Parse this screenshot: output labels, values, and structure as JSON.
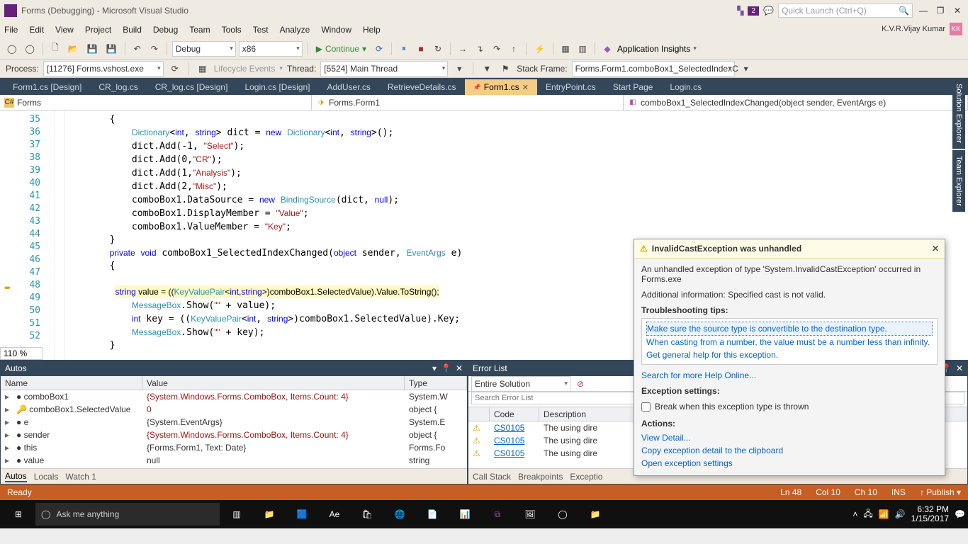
{
  "title": "Forms (Debugging) - Microsoft Visual Studio",
  "quicklaunch_placeholder": "Quick Launch (Ctrl+Q)",
  "user": {
    "name": "K.V.R.Vijay Kumar",
    "initials": "KK"
  },
  "notif_count": "2",
  "menu": [
    "File",
    "Edit",
    "View",
    "Project",
    "Build",
    "Debug",
    "Team",
    "Tools",
    "Test",
    "Analyze",
    "Window",
    "Help"
  ],
  "toolbar": {
    "config": "Debug",
    "platform": "x86",
    "continue": "Continue",
    "insights": "Application Insights"
  },
  "debugbar": {
    "process_label": "Process:",
    "process": "[11276] Forms.vshost.exe",
    "lifecycle": "Lifecycle Events",
    "thread_label": "Thread:",
    "thread": "[5524] Main Thread",
    "stackframe_label": "Stack Frame:",
    "stackframe": "Forms.Form1.comboBox1_SelectedIndexC"
  },
  "tabs": [
    "Form1.cs [Design]",
    "CR_log.cs",
    "CR_log.cs [Design]",
    "Login.cs [Design]",
    "AddUser.cs",
    "RetrieveDetails.cs",
    "Form1.cs",
    "EntryPoint.cs",
    "Start Page",
    "Login.cs"
  ],
  "active_tab": "Form1.cs",
  "nav": {
    "left": "Forms",
    "mid": "Forms.Form1",
    "right": "comboBox1_SelectedIndexChanged(object sender, EventArgs e)"
  },
  "lines": {
    "start": 35,
    "end": 52
  },
  "zoom": "110 %",
  "side_tabs": [
    "Solution Explorer",
    "Team Explorer"
  ],
  "autos": {
    "title": "Autos",
    "cols": [
      "Name",
      "Value",
      "Type"
    ],
    "rows": [
      {
        "name": "comboBox1",
        "value": "{System.Windows.Forms.ComboBox, Items.Count: 4}",
        "type": "System.W",
        "red": true
      },
      {
        "name": "comboBox1.SelectedValue",
        "value": "0",
        "type": "object {",
        "red": true,
        "key": true
      },
      {
        "name": "e",
        "value": "{System.EventArgs}",
        "type": "System.E"
      },
      {
        "name": "sender",
        "value": "{System.Windows.Forms.ComboBox, Items.Count: 4}",
        "type": "object {",
        "red": true
      },
      {
        "name": "this",
        "value": "{Forms.Form1, Text: Date}",
        "type": "Forms.Fo"
      },
      {
        "name": "value",
        "value": "null",
        "type": "string"
      }
    ],
    "tabs": [
      "Autos",
      "Locals",
      "Watch 1"
    ]
  },
  "errorlist": {
    "title": "Error List",
    "scope": "Entire Solution",
    "search_placeholder": "Search Error List",
    "cols": [
      "",
      "Code",
      "Description"
    ],
    "rows": [
      {
        "code": "CS0105",
        "desc": "The using dire"
      },
      {
        "code": "CS0105",
        "desc": "The using dire"
      },
      {
        "code": "CS0105",
        "desc": "The using dire"
      }
    ],
    "tabs": [
      "Call Stack",
      "Breakpoints",
      "Exceptio"
    ]
  },
  "exception": {
    "title": "InvalidCastException was unhandled",
    "msg1": "An unhandled exception of type 'System.InvalidCastException' occurred in Forms.exe",
    "msg2": "Additional information: Specified cast is not valid.",
    "tips_h": "Troubleshooting tips:",
    "tips": [
      "Make sure the source type is convertible to the destination type.",
      "When casting from a number, the value must be a number less than infinity.",
      "Get general help for this exception."
    ],
    "search": "Search for more Help Online...",
    "settings_h": "Exception settings:",
    "break_label": "Break when this exception type is thrown",
    "actions_h": "Actions:",
    "actions": [
      "View Detail...",
      "Copy exception detail to the clipboard",
      "Open exception settings"
    ]
  },
  "status": {
    "ready": "Ready",
    "ln": "Ln 48",
    "col": "Col 10",
    "ch": "Ch 10",
    "ins": "INS",
    "publish": "Publish"
  },
  "taskbar": {
    "search": "Ask me anything",
    "time": "6:32 PM",
    "date": "1/15/2017"
  }
}
